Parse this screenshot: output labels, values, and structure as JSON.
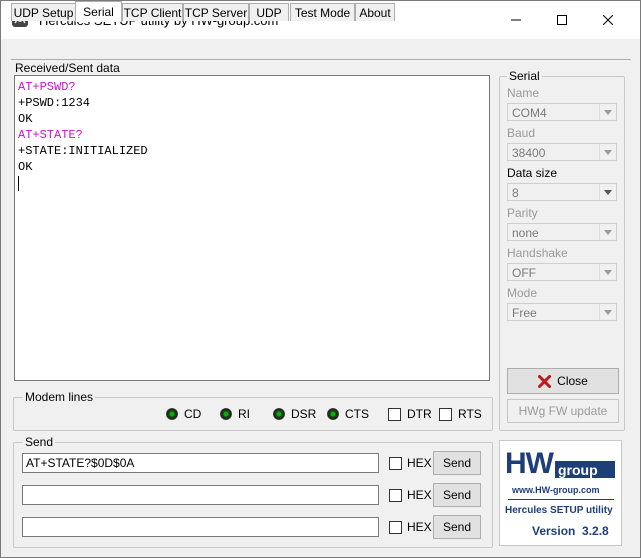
{
  "window": {
    "title": "Hercules SETUP utility by HW-group.com"
  },
  "tabs": [
    "UDP Setup",
    "Serial",
    "TCP Client",
    "TCP Server",
    "UDP",
    "Test Mode",
    "About"
  ],
  "received": {
    "label": "Received/Sent data",
    "lines": [
      {
        "text": "AT+PSWD?",
        "color": "#d010d0"
      },
      {
        "text": "+PSWD:1234",
        "color": "#000000"
      },
      {
        "text": "OK",
        "color": "#000000"
      },
      {
        "text": "AT+STATE?",
        "color": "#d010d0"
      },
      {
        "text": "+STATE:INITIALIZED",
        "color": "#000000"
      },
      {
        "text": "OK",
        "color": "#000000"
      }
    ]
  },
  "modem": {
    "title": "Modem lines",
    "leds": [
      "CD",
      "RI",
      "DSR",
      "CTS"
    ],
    "checks": [
      "DTR",
      "RTS"
    ]
  },
  "send": {
    "title": "Send",
    "rows": [
      {
        "value": "AT+STATE?$0D$0A",
        "hex": "HEX",
        "button": "Send"
      },
      {
        "value": "",
        "hex": "HEX",
        "button": "Send"
      },
      {
        "value": "",
        "hex": "HEX",
        "button": "Send"
      }
    ]
  },
  "serial": {
    "title": "Serial",
    "fields": [
      {
        "label": "Name",
        "value": "COM4",
        "enabled": false
      },
      {
        "label": "Baud",
        "value": "38400",
        "enabled": false
      },
      {
        "label": "Data size",
        "value": "8",
        "enabled": true
      },
      {
        "label": "Parity",
        "value": "none",
        "enabled": false
      },
      {
        "label": "Handshake",
        "value": "OFF",
        "enabled": false
      },
      {
        "label": "Mode",
        "value": "Free",
        "enabled": false
      }
    ],
    "close_label": "Close",
    "fw_update_label": "HWg FW update"
  },
  "logo": {
    "brand": "HW",
    "group": "group",
    "url": "www.HW-group.com",
    "product": "Hercules SETUP utility",
    "version": "Version  3.2.8"
  },
  "colors": {
    "accent": "#1e3e7a",
    "close_x": "#c01818",
    "led_on": "#0fa80f"
  }
}
